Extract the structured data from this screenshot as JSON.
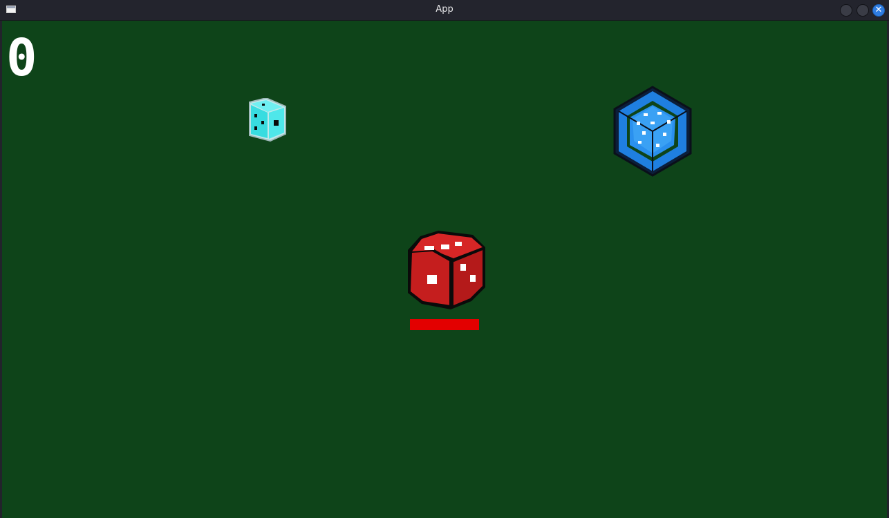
{
  "window": {
    "title": "App",
    "close_glyph": "✕"
  },
  "game": {
    "score": "0",
    "player": {
      "icon": "red-die-icon",
      "health": 1.0
    },
    "enemies": [
      {
        "icon": "cyan-die-icon"
      },
      {
        "icon": "blue-d20-icon"
      }
    ]
  },
  "colors": {
    "background": "#0e4419",
    "titlebar": "#23242d",
    "health": "#e30000",
    "player_die": "#c51e1e",
    "cyan_die": "#3ee2e6",
    "blue_die": "#1f7fe0"
  }
}
